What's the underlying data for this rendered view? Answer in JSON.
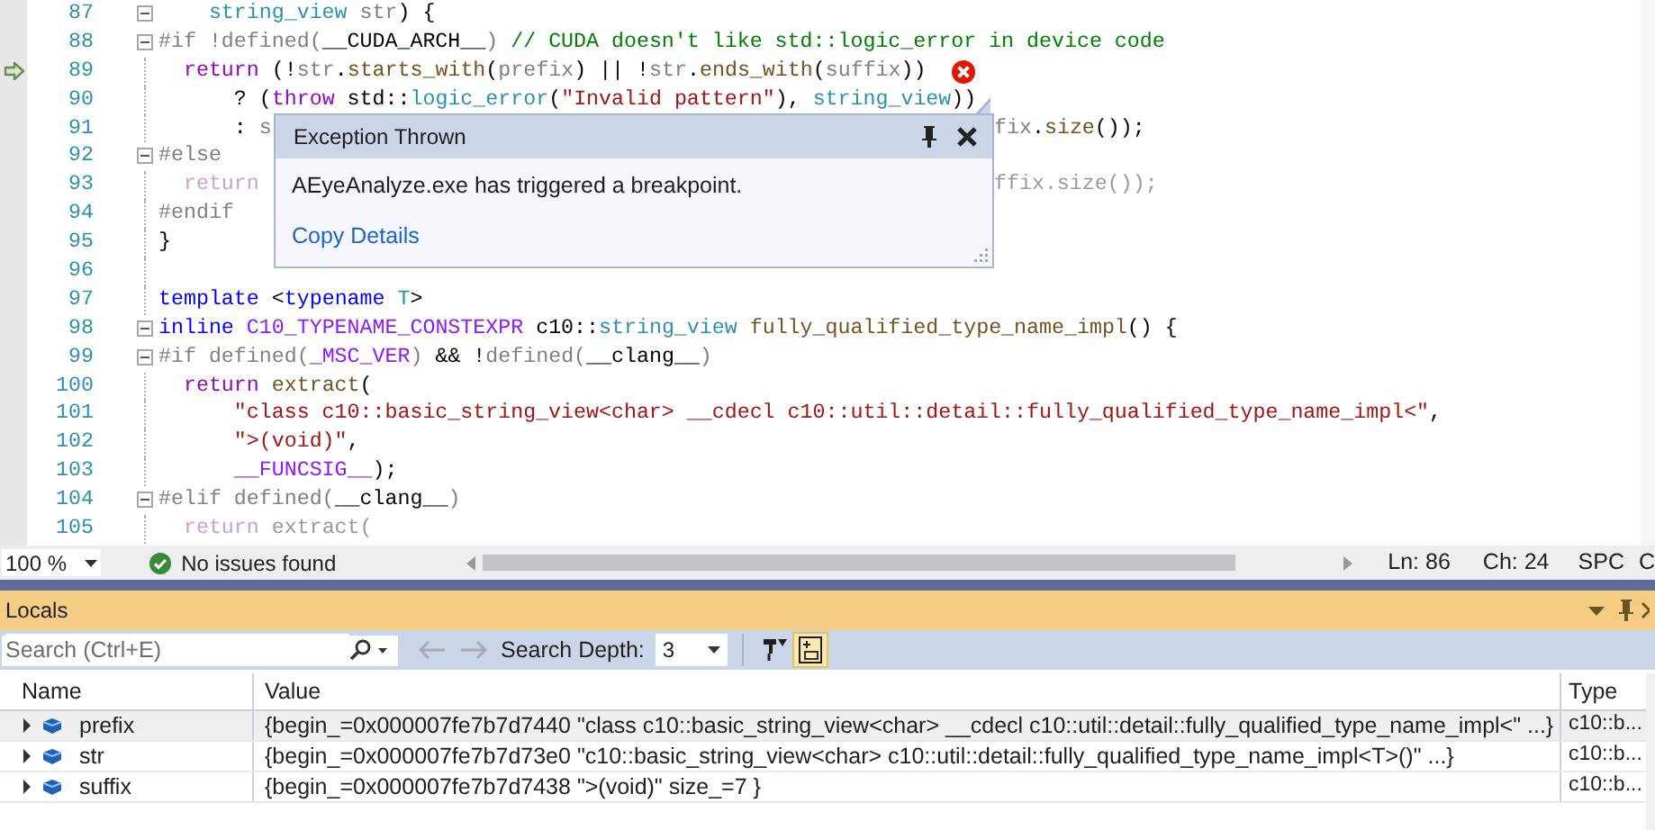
{
  "editor": {
    "lines": [
      {
        "num": "87",
        "fold": true,
        "current": false,
        "error": false,
        "tokens": [
          {
            "kind": "type",
            "text": "    string_view"
          },
          {
            "kind": "param",
            "text": " str"
          },
          {
            "kind": "plain",
            "text": ") {"
          }
        ]
      },
      {
        "num": "88",
        "fold": true,
        "current": false,
        "error": false,
        "tokens": [
          {
            "kind": "pp",
            "text": "#if !defined("
          },
          {
            "kind": "plain",
            "text": "__CUDA_ARCH__"
          },
          {
            "kind": "pp",
            "text": ")"
          },
          {
            "kind": "comment",
            "text": " // CUDA doesn't like std::logic_error in device code"
          }
        ]
      },
      {
        "num": "89",
        "fold": false,
        "current": true,
        "error": true,
        "tokens": [
          {
            "kind": "control",
            "text": "  return"
          },
          {
            "kind": "plain",
            "text": " (!"
          },
          {
            "kind": "param",
            "text": "str"
          },
          {
            "kind": "plain",
            "text": "."
          },
          {
            "kind": "func",
            "text": "starts_with"
          },
          {
            "kind": "plain",
            "text": "("
          },
          {
            "kind": "param",
            "text": "prefix"
          },
          {
            "kind": "plain",
            "text": ") || !"
          },
          {
            "kind": "param",
            "text": "str"
          },
          {
            "kind": "plain",
            "text": "."
          },
          {
            "kind": "func",
            "text": "ends_with"
          },
          {
            "kind": "plain",
            "text": "("
          },
          {
            "kind": "param",
            "text": "suffix"
          },
          {
            "kind": "plain",
            "text": "))"
          }
        ]
      },
      {
        "num": "90",
        "fold": false,
        "current": false,
        "error": false,
        "tokens": [
          {
            "kind": "plain",
            "text": "      ? ("
          },
          {
            "kind": "control",
            "text": "throw"
          },
          {
            "kind": "plain",
            "text": " std::"
          },
          {
            "kind": "type",
            "text": "logic_error"
          },
          {
            "kind": "plain",
            "text": "("
          },
          {
            "kind": "string",
            "text": "\"Invalid pattern\""
          },
          {
            "kind": "plain",
            "text": "), "
          },
          {
            "kind": "type",
            "text": "string_view"
          },
          {
            "kind": "plain",
            "text": "))"
          }
        ]
      },
      {
        "num": "91",
        "fold": false,
        "current": false,
        "error": false,
        "tokens": [
          {
            "kind": "plain",
            "text": "      : "
          },
          {
            "kind": "param",
            "text": "s"
          }
        ],
        "tokens_after_popup": [
          {
            "kind": "param",
            "text": "fix"
          },
          {
            "kind": "plain",
            "text": "."
          },
          {
            "kind": "func",
            "text": "size"
          },
          {
            "kind": "plain",
            "text": "());"
          }
        ]
      },
      {
        "num": "92",
        "fold": true,
        "current": false,
        "error": false,
        "tokens": [
          {
            "kind": "pp",
            "text": "#else"
          }
        ]
      },
      {
        "num": "93",
        "fold": false,
        "current": false,
        "error": false,
        "tokens": [
          {
            "kind": "dimcontrol",
            "text": "  return"
          }
        ],
        "tokens_after_popup": [
          {
            "kind": "dim",
            "text": "ffix.size());"
          }
        ]
      },
      {
        "num": "94",
        "fold": false,
        "current": false,
        "error": false,
        "tokens": [
          {
            "kind": "pp",
            "text": "#endif"
          }
        ]
      },
      {
        "num": "95",
        "fold": false,
        "current": false,
        "error": false,
        "tokens": [
          {
            "kind": "plain",
            "text": "}"
          }
        ]
      },
      {
        "num": "96",
        "fold": false,
        "current": false,
        "error": false
      },
      {
        "num": "97",
        "fold": false,
        "current": false,
        "error": false,
        "tokens": [
          {
            "kind": "keyword",
            "text": "template"
          },
          {
            "kind": "plain",
            "text": " <"
          },
          {
            "kind": "keyword",
            "text": "typename"
          },
          {
            "kind": "type",
            "text": " T"
          },
          {
            "kind": "plain",
            "text": ">"
          }
        ]
      },
      {
        "num": "98",
        "fold": true,
        "current": false,
        "error": false,
        "tokens": [
          {
            "kind": "keyword",
            "text": "inline"
          },
          {
            "kind": "macro",
            "text": " C10_TYPENAME_CONSTEXPR"
          },
          {
            "kind": "plain",
            "text": " c10::"
          },
          {
            "kind": "type",
            "text": "string_view"
          },
          {
            "kind": "func",
            "text": " fully_qualified_type_name_impl"
          },
          {
            "kind": "plain",
            "text": "() {"
          }
        ]
      },
      {
        "num": "99",
        "fold": true,
        "current": false,
        "error": false,
        "tokens": [
          {
            "kind": "pp",
            "text": "#if defined("
          },
          {
            "kind": "macro",
            "text": "_MSC_VER"
          },
          {
            "kind": "pp",
            "text": ")"
          },
          {
            "kind": "plain",
            "text": " && !"
          },
          {
            "kind": "pp",
            "text": "defined("
          },
          {
            "kind": "plain",
            "text": "__clang__"
          },
          {
            "kind": "pp",
            "text": ")"
          }
        ]
      },
      {
        "num": "100",
        "fold": false,
        "current": false,
        "error": false,
        "tokens": [
          {
            "kind": "control",
            "text": "  return"
          },
          {
            "kind": "func",
            "text": " extract"
          },
          {
            "kind": "plain",
            "text": "("
          }
        ]
      },
      {
        "num": "101",
        "fold": false,
        "current": false,
        "error": false,
        "tokens": [
          {
            "kind": "string",
            "text": "      \"class c10::basic_string_view<char> __cdecl c10::util::detail::fully_qualified_type_name_impl<\""
          },
          {
            "kind": "plain",
            "text": ","
          }
        ]
      },
      {
        "num": "102",
        "fold": false,
        "current": false,
        "error": false,
        "tokens": [
          {
            "kind": "string",
            "text": "      \">(void)\""
          },
          {
            "kind": "plain",
            "text": ","
          }
        ]
      },
      {
        "num": "103",
        "fold": false,
        "current": false,
        "error": false,
        "tokens": [
          {
            "kind": "macro",
            "text": "      __FUNCSIG__"
          },
          {
            "kind": "plain",
            "text": ");"
          }
        ]
      },
      {
        "num": "104",
        "fold": true,
        "current": false,
        "error": false,
        "tokens": [
          {
            "kind": "pp",
            "text": "#elif defined("
          },
          {
            "kind": "plain",
            "text": "__clang__"
          },
          {
            "kind": "pp",
            "text": ")"
          }
        ]
      },
      {
        "num": "105",
        "fold": false,
        "current": false,
        "error": false,
        "tokens": [
          {
            "kind": "dimcontrol",
            "text": "  return"
          },
          {
            "kind": "dim",
            "text": " extract("
          }
        ]
      }
    ]
  },
  "popup": {
    "title": "Exception Thrown",
    "message": "AEyeAnalyze.exe has triggered a breakpoint.",
    "link": "Copy Details"
  },
  "status_bar": {
    "zoom": "100 %",
    "issues": "No issues found",
    "line": "Ln: 86",
    "column": "Ch: 24",
    "indent": "SPC",
    "eol": "C"
  },
  "locals": {
    "title": "Locals",
    "search": {
      "placeholder": "Search (Ctrl+E)"
    },
    "depth_label": "Search Depth:",
    "depth": "3",
    "toggles": [
      {
        "selected": false
      },
      {
        "selected": true
      }
    ],
    "columns": [
      "Name",
      "Value",
      "Type"
    ],
    "rows": [
      {
        "name": "prefix",
        "value": "{begin_=0x000007fe7b7d7440 \"class c10::basic_string_view<char> __cdecl c10::util::detail::fully_qualified_type_name_impl<\" ...}",
        "type": "c10::b...",
        "selected": true,
        "expanded": false
      },
      {
        "name": "str",
        "value": "{begin_=0x000007fe7b7d73e0 \"c10::basic_string_view<char> c10::util::detail::fully_qualified_type_name_impl<T>()\" ...}",
        "type": "c10::b...",
        "selected": false,
        "expanded": false
      },
      {
        "name": "suffix",
        "value": "{begin_=0x000007fe7b7d7438 \">(void)\" size_=7 }",
        "type": "c10::b...",
        "selected": false,
        "expanded": false
      }
    ]
  }
}
